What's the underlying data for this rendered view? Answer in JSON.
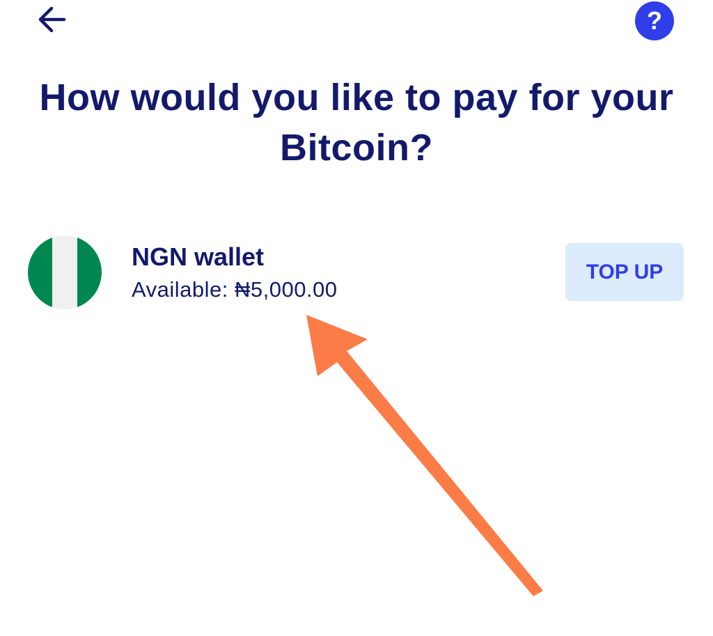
{
  "header": {
    "back_icon": "arrow-left-icon",
    "help_label": "?",
    "help_color": "#2f3ee8"
  },
  "title": "How would you like to pay for your Bitcoin?",
  "wallet": {
    "flag": "nigeria-flag-icon",
    "flag_colors": [
      "#008751",
      "#f0f0f0",
      "#008751"
    ],
    "name": "NGN wallet",
    "balance": "Available: ₦5,000.00",
    "topup_label": "TOP UP"
  },
  "annotation": {
    "type": "arrow",
    "color": "#fb7c47"
  }
}
